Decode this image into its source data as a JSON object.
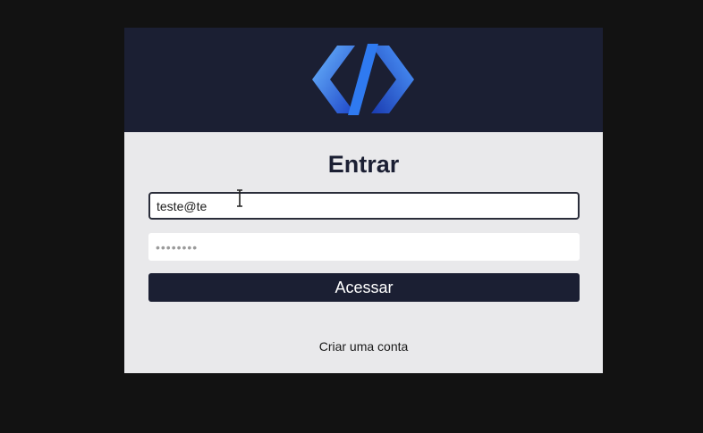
{
  "form": {
    "title": "Entrar",
    "email_value": "teste@te",
    "password_placeholder": "••••••••",
    "submit_label": "Acessar",
    "create_account_label": "Criar uma conta"
  },
  "icons": {
    "logo": "code-brackets-logo-icon",
    "cursor": "text-cursor-icon"
  },
  "colors": {
    "header_bg": "#1b1f33",
    "card_bg": "#e9e9eb",
    "page_bg": "#121212",
    "logo_blue_light": "#5aa8ff",
    "logo_blue_dark": "#1f4fd6"
  }
}
